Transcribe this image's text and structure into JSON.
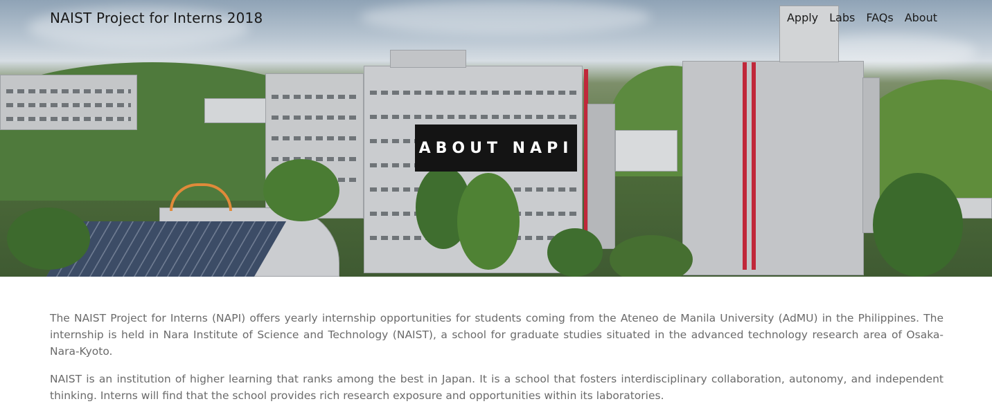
{
  "header": {
    "site_title": "NAIST Project for Interns 2018",
    "nav": [
      {
        "label": "Apply"
      },
      {
        "label": "Labs"
      },
      {
        "label": "FAQs"
      },
      {
        "label": "About"
      }
    ]
  },
  "hero": {
    "heading": "ABOUT NAPI"
  },
  "main": {
    "paragraphs": [
      "The NAIST Project for Interns (NAPI) offers yearly internship opportunities for students coming from the Ateneo de Manila University (AdMU) in the Philippines. The internship is held in Nara Institute of Science and Technology (NAIST), a school for graduate studies situated in the advanced technology research area of Osaka-Nara-Kyoto.",
      "NAIST is an institution of higher learning that ranks among the best in Japan. It is a school that fosters interdisciplinary collaboration, autonomy, and independent thinking. Interns will find that the school provides rich research exposure and opportunities within its laboratories."
    ]
  }
}
